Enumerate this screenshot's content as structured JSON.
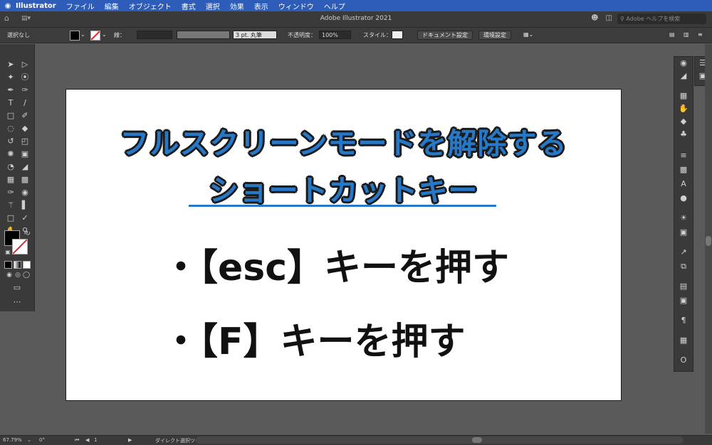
{
  "menubar": {
    "apple": "",
    "app": "Illustrator",
    "items": [
      "ファイル",
      "編集",
      "オブジェクト",
      "書式",
      "選択",
      "効果",
      "表示",
      "ウィンドウ",
      "ヘルプ"
    ]
  },
  "titlebar": {
    "title": "Adobe Illustrator 2021",
    "search_placeholder": "Adobe ヘルプを検索"
  },
  "controlbar": {
    "selection": "選択なし",
    "stroke_label": "線：",
    "brush": "3 pt. 丸筆",
    "opacity_label": "不透明度：",
    "opacity_value": "100%",
    "style_label": "スタイル：",
    "doc_settings": "ドキュメント設定",
    "prefs": "環境設定"
  },
  "artboard": {
    "title_line1": "フルスクリーンモードを解除する",
    "title_line2": "ショートカットキー",
    "bullet1": "・【esc】キーを押す",
    "bullet2": "・【F】キーを押す"
  },
  "statusbar": {
    "zoom": "67.79%",
    "rotate": "0°",
    "page": "1",
    "status": "ダイレクト選択ツールを切り換え"
  },
  "colors": {
    "menubar": "#2d5db8",
    "title_blue": "#2878c8",
    "panel": "#3a3a3a",
    "canvas_bg": "#5a5a5a"
  }
}
